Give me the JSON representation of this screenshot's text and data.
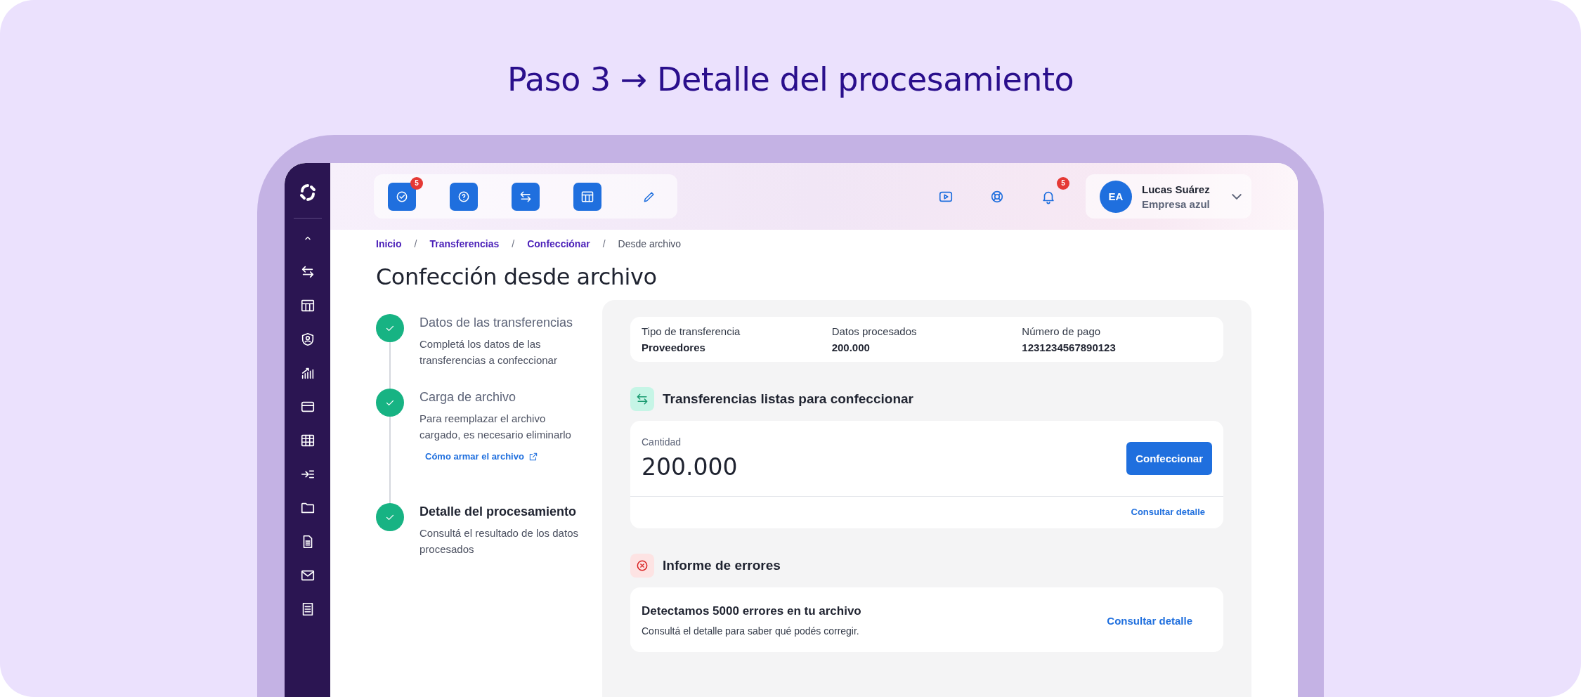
{
  "heading": "Paso 3 → Detalle del procesamiento",
  "toolbar": {
    "badge": "5"
  },
  "notifications": {
    "badge": "5"
  },
  "user": {
    "initials": "EA",
    "name": "Lucas Suárez",
    "company": "Empresa azul"
  },
  "breadcrumb_separator": "/",
  "breadcrumb": [
    {
      "label": "Inicio",
      "current": false
    },
    {
      "label": "Transferencias",
      "current": false
    },
    {
      "label": "Confecciónar",
      "current": false
    },
    {
      "label": "Desde archivo",
      "current": true
    }
  ],
  "page_title": "Confección desde archivo",
  "steps": [
    {
      "title": "Datos de las transferencias",
      "description": "Completá los datos de las transferencias a confeccionar",
      "completed": true,
      "selected": false
    },
    {
      "title": "Carga de archivo",
      "description": "Para reemplazar el archivo cargado, es necesario eliminarlo",
      "completed": true,
      "selected": false,
      "link": "Cómo armar el archivo"
    },
    {
      "title": "Detalle del procesamiento",
      "description": "Consultá el resultado de los datos procesados",
      "completed": true,
      "selected": true
    }
  ],
  "summary": [
    {
      "label": "Tipo de transferencia",
      "value": "Proveedores"
    },
    {
      "label": "Datos procesados",
      "value": "200.000"
    },
    {
      "label": "Número de pago",
      "value": "1231234567890123"
    }
  ],
  "ready_section": {
    "title": "Transferencias listas para confeccionar",
    "quantity_label": "Cantidad",
    "quantity": "200.000",
    "button": "Confeccionar",
    "detail_link": "Consultar detalle"
  },
  "errors_section": {
    "title": "Informe de errores",
    "message": "Detectamos 5000 errores en tu archivo",
    "hint": "Consultá el detalle para saber qué podés corregir.",
    "detail_link": "Consultar detalle"
  }
}
